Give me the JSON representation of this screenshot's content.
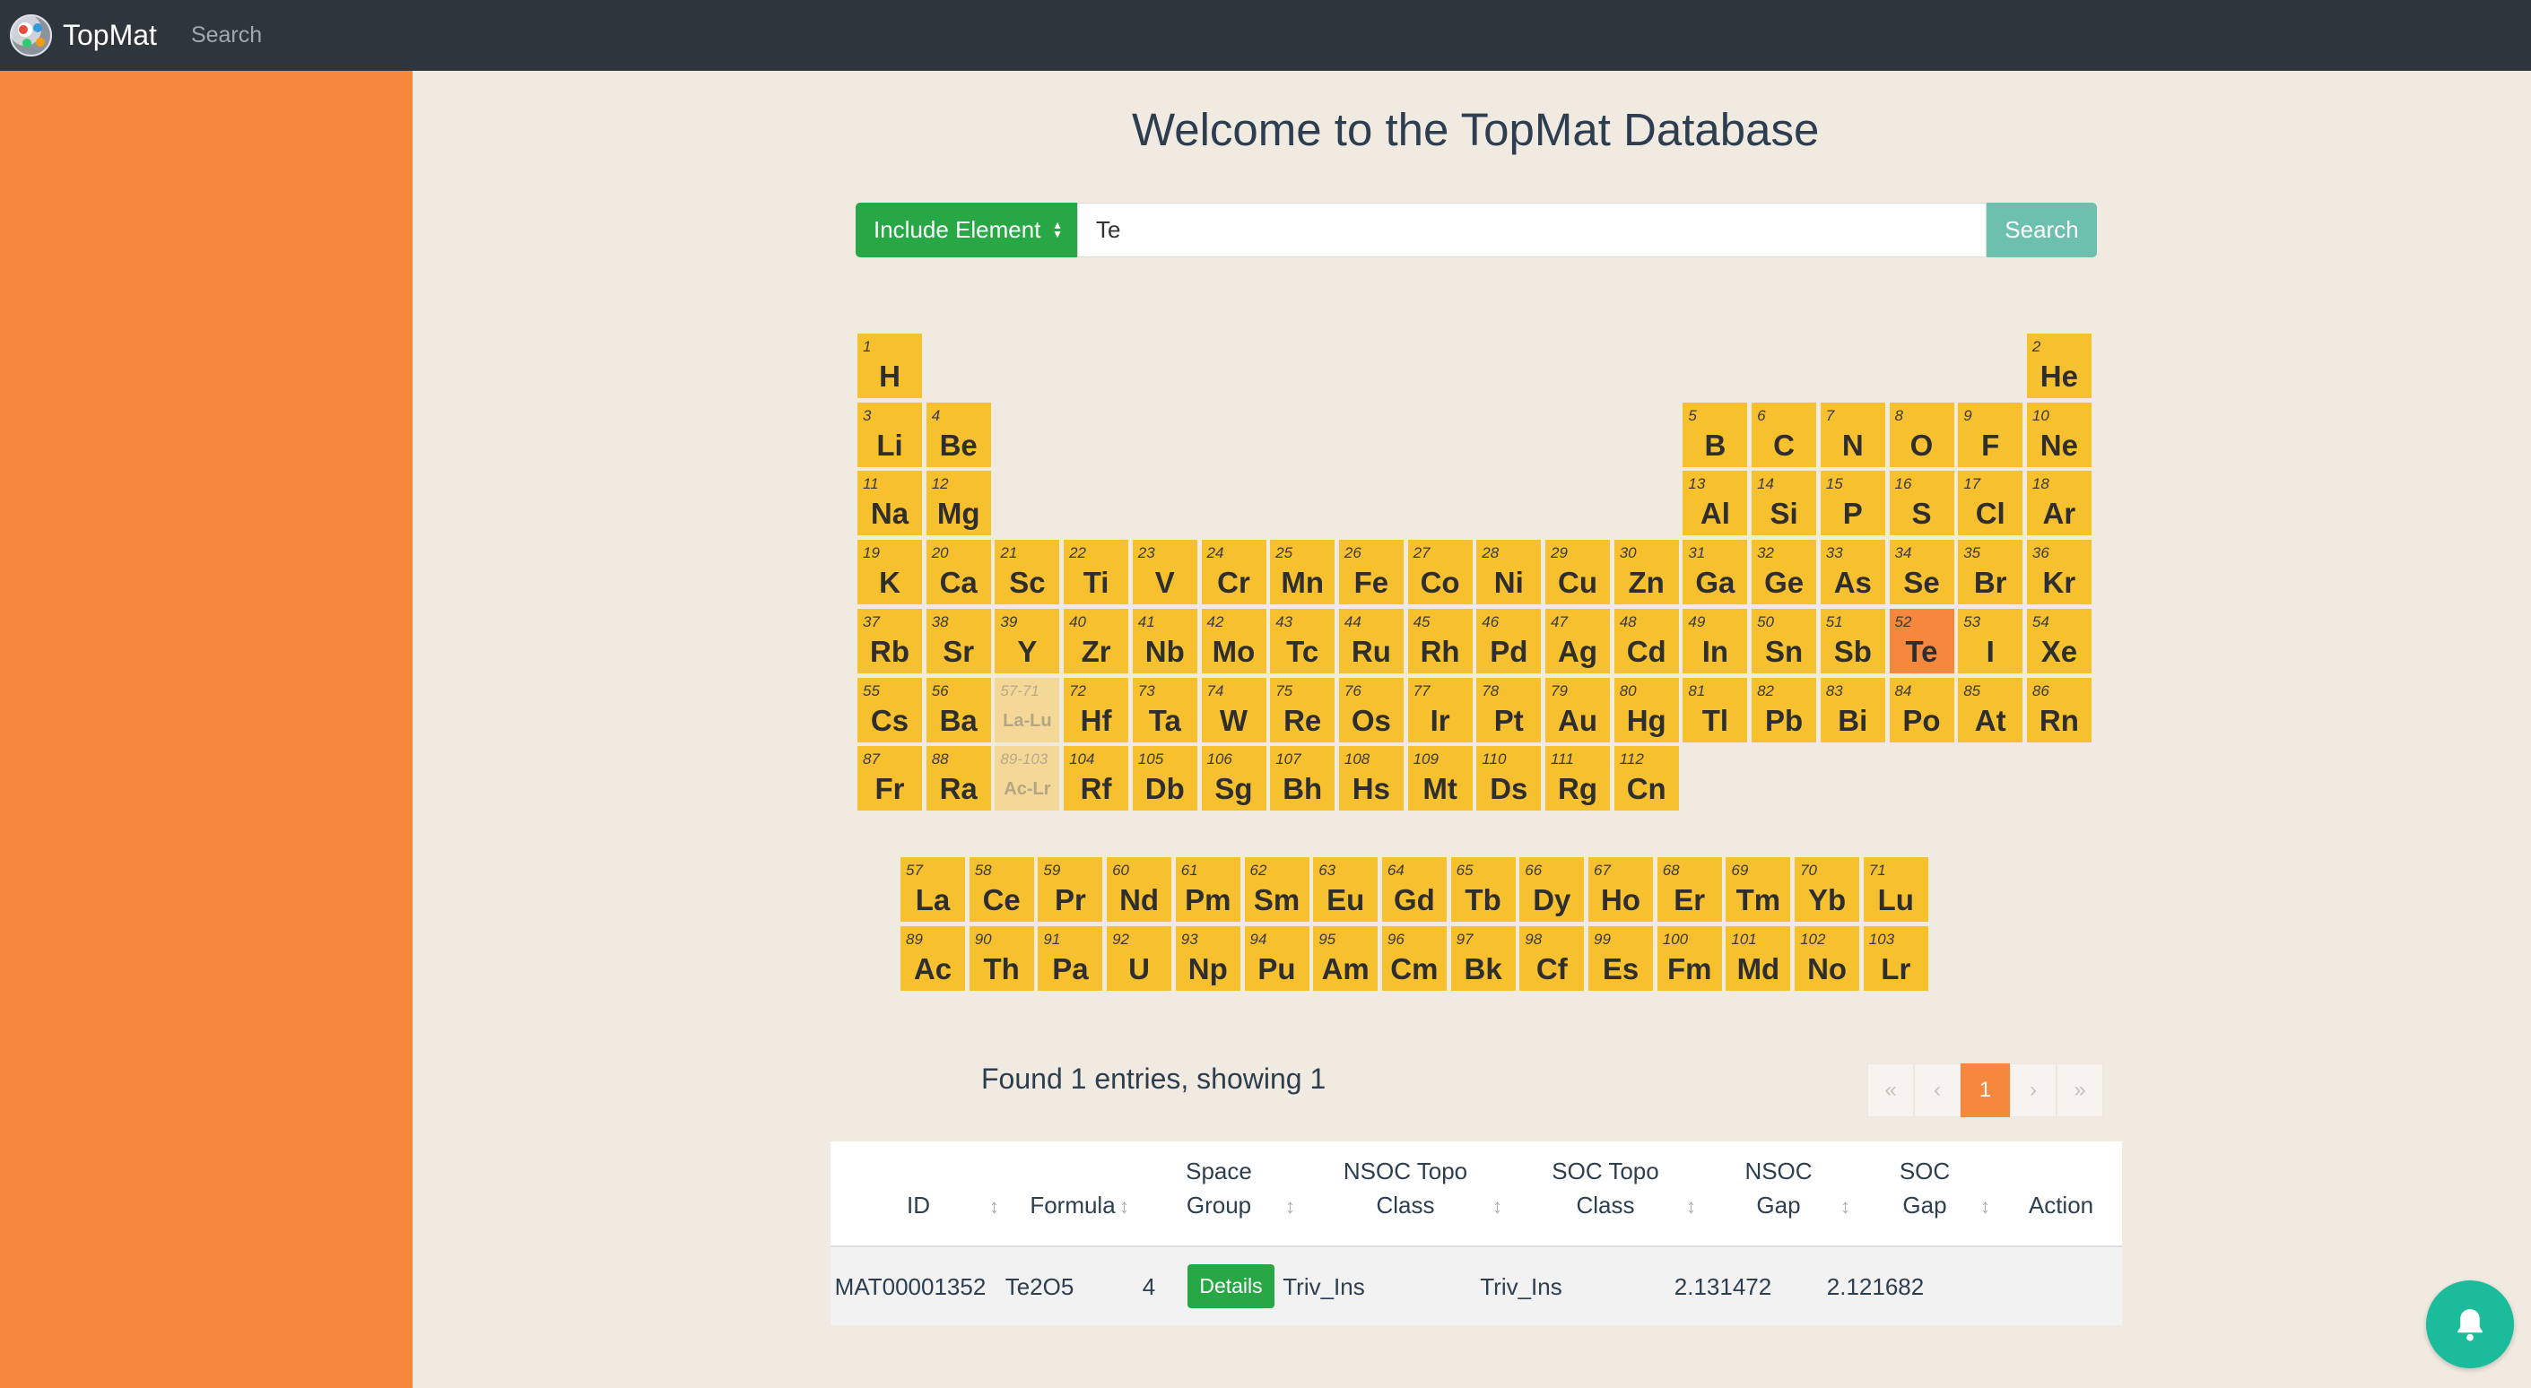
{
  "header": {
    "brand": "TopMat",
    "nav_search": "Search"
  },
  "main": {
    "title": "Welcome to the TopMat Database",
    "search": {
      "mode_label": "Include Element",
      "value": "Te",
      "button": "Search"
    }
  },
  "periodic_table": {
    "highlighted": "Te",
    "main": [
      [
        [
          1,
          "H"
        ],
        [
          2,
          "He"
        ]
      ],
      [
        [
          3,
          "Li"
        ],
        [
          4,
          "Be"
        ],
        [
          5,
          "B"
        ],
        [
          6,
          "C"
        ],
        [
          7,
          "N"
        ],
        [
          8,
          "O"
        ],
        [
          9,
          "F"
        ],
        [
          10,
          "Ne"
        ]
      ],
      [
        [
          11,
          "Na"
        ],
        [
          12,
          "Mg"
        ],
        [
          13,
          "Al"
        ],
        [
          14,
          "Si"
        ],
        [
          15,
          "P"
        ],
        [
          16,
          "S"
        ],
        [
          17,
          "Cl"
        ],
        [
          18,
          "Ar"
        ]
      ],
      [
        [
          19,
          "K"
        ],
        [
          20,
          "Ca"
        ],
        [
          21,
          "Sc"
        ],
        [
          22,
          "Ti"
        ],
        [
          23,
          "V"
        ],
        [
          24,
          "Cr"
        ],
        [
          25,
          "Mn"
        ],
        [
          26,
          "Fe"
        ],
        [
          27,
          "Co"
        ],
        [
          28,
          "Ni"
        ],
        [
          29,
          "Cu"
        ],
        [
          30,
          "Zn"
        ],
        [
          31,
          "Ga"
        ],
        [
          32,
          "Ge"
        ],
        [
          33,
          "As"
        ],
        [
          34,
          "Se"
        ],
        [
          35,
          "Br"
        ],
        [
          36,
          "Kr"
        ]
      ],
      [
        [
          37,
          "Rb"
        ],
        [
          38,
          "Sr"
        ],
        [
          39,
          "Y"
        ],
        [
          40,
          "Zr"
        ],
        [
          41,
          "Nb"
        ],
        [
          42,
          "Mo"
        ],
        [
          43,
          "Tc"
        ],
        [
          44,
          "Ru"
        ],
        [
          45,
          "Rh"
        ],
        [
          46,
          "Pd"
        ],
        [
          47,
          "Ag"
        ],
        [
          48,
          "Cd"
        ],
        [
          49,
          "In"
        ],
        [
          50,
          "Sn"
        ],
        [
          51,
          "Sb"
        ],
        [
          52,
          "Te"
        ],
        [
          53,
          "I"
        ],
        [
          54,
          "Xe"
        ]
      ],
      [
        [
          55,
          "Cs"
        ],
        [
          56,
          "Ba"
        ],
        [
          "57-71",
          "La-Lu"
        ],
        [
          72,
          "Hf"
        ],
        [
          73,
          "Ta"
        ],
        [
          74,
          "W"
        ],
        [
          75,
          "Re"
        ],
        [
          76,
          "Os"
        ],
        [
          77,
          "Ir"
        ],
        [
          78,
          "Pt"
        ],
        [
          79,
          "Au"
        ],
        [
          80,
          "Hg"
        ],
        [
          81,
          "Tl"
        ],
        [
          82,
          "Pb"
        ],
        [
          83,
          "Bi"
        ],
        [
          84,
          "Po"
        ],
        [
          85,
          "At"
        ],
        [
          86,
          "Rn"
        ]
      ],
      [
        [
          87,
          "Fr"
        ],
        [
          88,
          "Ra"
        ],
        [
          "89-103",
          "Ac-Lr"
        ],
        [
          104,
          "Rf"
        ],
        [
          105,
          "Db"
        ],
        [
          106,
          "Sg"
        ],
        [
          107,
          "Bh"
        ],
        [
          108,
          "Hs"
        ],
        [
          109,
          "Mt"
        ],
        [
          110,
          "Ds"
        ],
        [
          111,
          "Rg"
        ],
        [
          112,
          "Cn"
        ]
      ]
    ],
    "lanthanides": [
      [
        57,
        "La"
      ],
      [
        58,
        "Ce"
      ],
      [
        59,
        "Pr"
      ],
      [
        60,
        "Nd"
      ],
      [
        61,
        "Pm"
      ],
      [
        62,
        "Sm"
      ],
      [
        63,
        "Eu"
      ],
      [
        64,
        "Gd"
      ],
      [
        65,
        "Tb"
      ],
      [
        66,
        "Dy"
      ],
      [
        67,
        "Ho"
      ],
      [
        68,
        "Er"
      ],
      [
        69,
        "Tm"
      ],
      [
        70,
        "Yb"
      ],
      [
        71,
        "Lu"
      ]
    ],
    "actinides": [
      [
        89,
        "Ac"
      ],
      [
        90,
        "Th"
      ],
      [
        91,
        "Pa"
      ],
      [
        92,
        "U"
      ],
      [
        93,
        "Np"
      ],
      [
        94,
        "Pu"
      ],
      [
        95,
        "Am"
      ],
      [
        96,
        "Cm"
      ],
      [
        97,
        "Bk"
      ],
      [
        98,
        "Cf"
      ],
      [
        99,
        "Es"
      ],
      [
        100,
        "Fm"
      ],
      [
        101,
        "Md"
      ],
      [
        102,
        "No"
      ],
      [
        103,
        "Lr"
      ]
    ]
  },
  "results": {
    "summary": "Found 1 entries, showing 1",
    "pagination": {
      "first": "«",
      "prev": "‹",
      "current": "1",
      "next": "›",
      "last": "»"
    },
    "columns": [
      "ID",
      "Formula",
      "Space\nGroup",
      "NSOC Topo\nClass",
      "SOC Topo\nClass",
      "NSOC\nGap",
      "SOC\nGap",
      "Action"
    ],
    "sort_icon": "↕",
    "rows": [
      {
        "id": "MAT00001352",
        "formula": "Te2O5",
        "space_group": "4",
        "nsoc_topo": "Triv_Ins",
        "soc_topo": "Triv_Ins",
        "nsoc_gap": "2.131472",
        "soc_gap": "2.121682",
        "action": "Details"
      }
    ]
  },
  "icons": {
    "bell": "bell-icon",
    "select_arrows": "sort-arrows-icon"
  },
  "colors": {
    "accent": "#f5883c",
    "element": "#f7c02f",
    "primary_button": "#28a745",
    "search_button": "#6dc0ae",
    "bell": "#1abc9c",
    "navbar": "#2f353c"
  }
}
